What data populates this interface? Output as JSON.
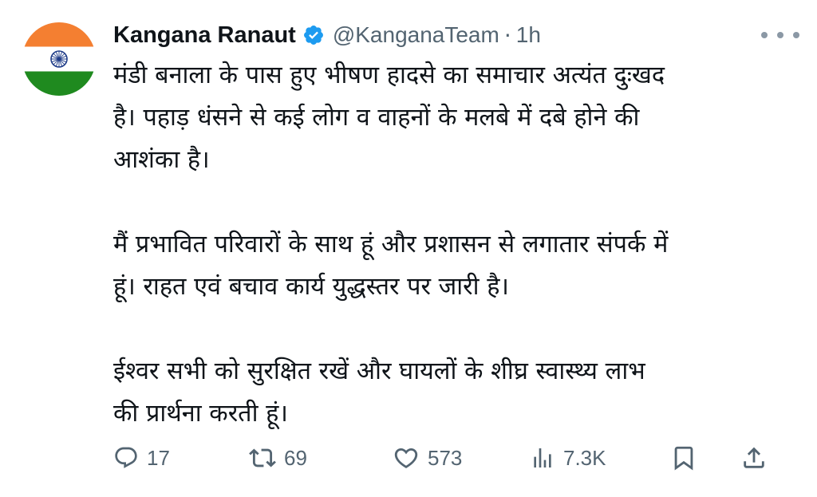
{
  "tweet": {
    "author_name": "Kangana Ranaut",
    "handle": "@KanganaTeam",
    "separator": "·",
    "time": "1h",
    "paragraphs": [
      [
        "मंडी बनाला के पास हुए भीषण हादसे का समाचार अत्यंत दुःखद",
        "है। पहाड़ धंसने से कई लोग व वाहनों के मलबे में दबे होने की",
        "आशंका है।"
      ],
      [
        "मैं प्रभावित परिवारों के साथ हूं और प्रशासन से लगातार संपर्क में",
        "हूं। राहत एवं बचाव कार्य युद्धस्तर पर जारी है।"
      ],
      [
        "ईश्वर सभी को सुरक्षित रखें और घायलों के शीघ्र स्वास्थ्य लाभ",
        "की प्रार्थना करती हूं।"
      ]
    ]
  },
  "actions": {
    "replies": "17",
    "reposts": "69",
    "likes": "573",
    "views": "7.3K"
  },
  "icons": {
    "avatar": "indian-flag-avatar",
    "verified": "verified-badge-icon",
    "more": "more-options-icon",
    "reply": "reply-icon",
    "repost": "repost-icon",
    "like": "heart-icon",
    "views": "views-icon",
    "bookmark": "bookmark-icon",
    "share": "share-icon"
  },
  "colors": {
    "text": "#0f1419",
    "secondary": "#536471",
    "verified": "#1d9bf0",
    "flag_saffron": "#f47f31",
    "flag_green": "#1f8a1f",
    "chakra": "#1f3c88"
  }
}
